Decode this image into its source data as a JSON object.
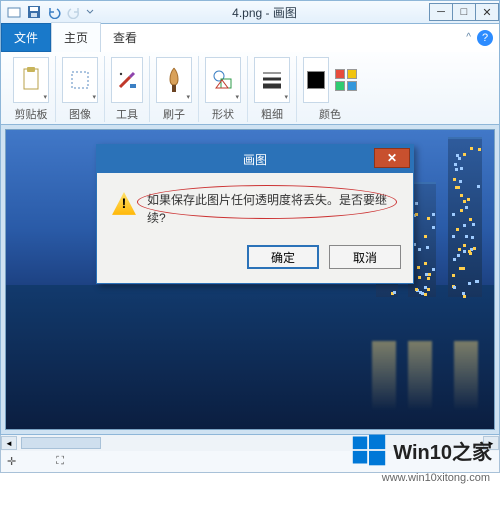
{
  "titlebar": {
    "title": "4.png - 画图",
    "qat": {
      "save": "save-icon",
      "undo": "undo-icon",
      "redo": "redo-icon"
    },
    "win": {
      "min": "─",
      "max": "□",
      "close": "✕"
    }
  },
  "tabs": {
    "file": "文件",
    "home": "主页",
    "view": "查看",
    "help": "?",
    "collapse": "^"
  },
  "ribbon": {
    "clipboard": {
      "label": "剪贴板"
    },
    "image": {
      "label": "图像"
    },
    "tools": {
      "label": "工具"
    },
    "brushes": {
      "label": "刷子"
    },
    "shapes": {
      "label": "形状"
    },
    "thickness": {
      "label": "粗细"
    },
    "colors": {
      "label": "颜色"
    }
  },
  "dialog": {
    "title": "画图",
    "message": "如果保存此图片任何透明度将丢失。是否要继续?",
    "ok": "确定",
    "cancel": "取消",
    "close": "✕"
  },
  "watermark": {
    "text": "Win10之家",
    "url": "www.win10xitong.com"
  },
  "statusbar": {
    "coords_icon": "✛",
    "size_icon": "⛶"
  },
  "scrollbar": {
    "left": "◄",
    "right": "►"
  }
}
